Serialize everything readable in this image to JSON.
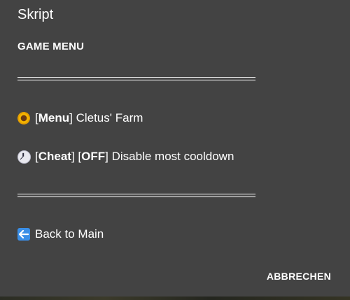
{
  "dialog": {
    "title": "Skript",
    "header": "GAME MENU",
    "items": [
      {
        "icon": "sunflower-icon",
        "tag": "Menu",
        "text": "Cletus' Farm"
      },
      {
        "icon": "clock-icon",
        "tag": "Cheat",
        "state": "OFF",
        "text": "Disable most cooldown"
      },
      {
        "icon": "back-arrow-icon",
        "text": "Back to Main"
      }
    ],
    "cancel_label": "ABBRECHEN"
  },
  "colors": {
    "dialog_background": "#434343",
    "text": "#ffffff",
    "back_icon": "#3a8ee6",
    "sunflower": "#f4b400"
  }
}
